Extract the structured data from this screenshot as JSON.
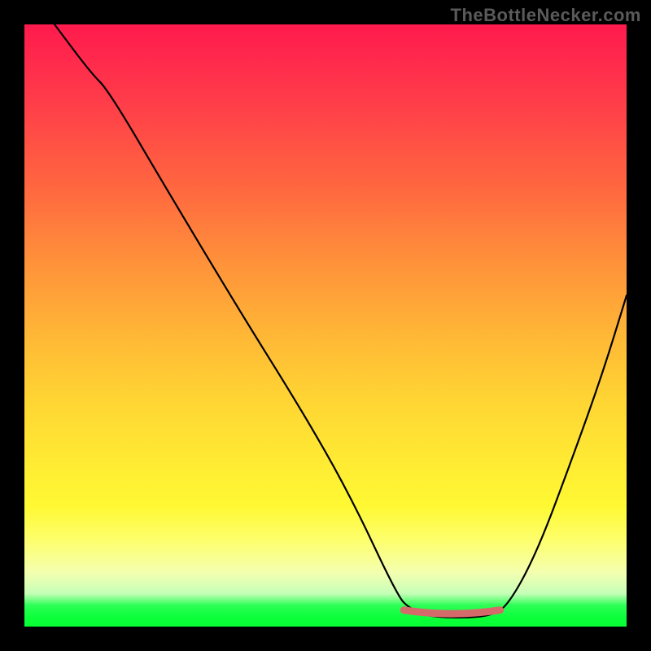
{
  "watermark": "TheBottleNecker.com",
  "chart_data": {
    "type": "line",
    "title": "",
    "xlabel": "",
    "ylabel": "",
    "xlim": [
      0,
      100
    ],
    "ylim": [
      0,
      100
    ],
    "curve_points_percent": [
      [
        5,
        100
      ],
      [
        11,
        92
      ],
      [
        14,
        89
      ],
      [
        24,
        72
      ],
      [
        36,
        52
      ],
      [
        46,
        36
      ],
      [
        54,
        22
      ],
      [
        62,
        5
      ],
      [
        64,
        3
      ],
      [
        67,
        1.8
      ],
      [
        70,
        1.5
      ],
      [
        74,
        1.5
      ],
      [
        77,
        1.8
      ],
      [
        80,
        3
      ],
      [
        85,
        12
      ],
      [
        91,
        28
      ],
      [
        96,
        42
      ],
      [
        100,
        55
      ]
    ],
    "valley_marker_percent": {
      "x_start": 63,
      "x_end": 79,
      "y": 2.2
    },
    "gradient_stops": [
      {
        "pos": 0,
        "color": "#ff1a4d"
      },
      {
        "pos": 0.12,
        "color": "#ff3a4a"
      },
      {
        "pos": 0.28,
        "color": "#ff6a3f"
      },
      {
        "pos": 0.4,
        "color": "#ff933a"
      },
      {
        "pos": 0.52,
        "color": "#ffb836"
      },
      {
        "pos": 0.62,
        "color": "#ffd433"
      },
      {
        "pos": 0.72,
        "color": "#ffe933"
      },
      {
        "pos": 0.8,
        "color": "#fff933"
      },
      {
        "pos": 0.86,
        "color": "#fdff70"
      },
      {
        "pos": 0.91,
        "color": "#f4ffb0"
      },
      {
        "pos": 0.945,
        "color": "#c6ffb8"
      },
      {
        "pos": 0.965,
        "color": "#2bff55"
      },
      {
        "pos": 0.985,
        "color": "#0bff3a"
      },
      {
        "pos": 1.0,
        "color": "#07ff32"
      }
    ]
  }
}
